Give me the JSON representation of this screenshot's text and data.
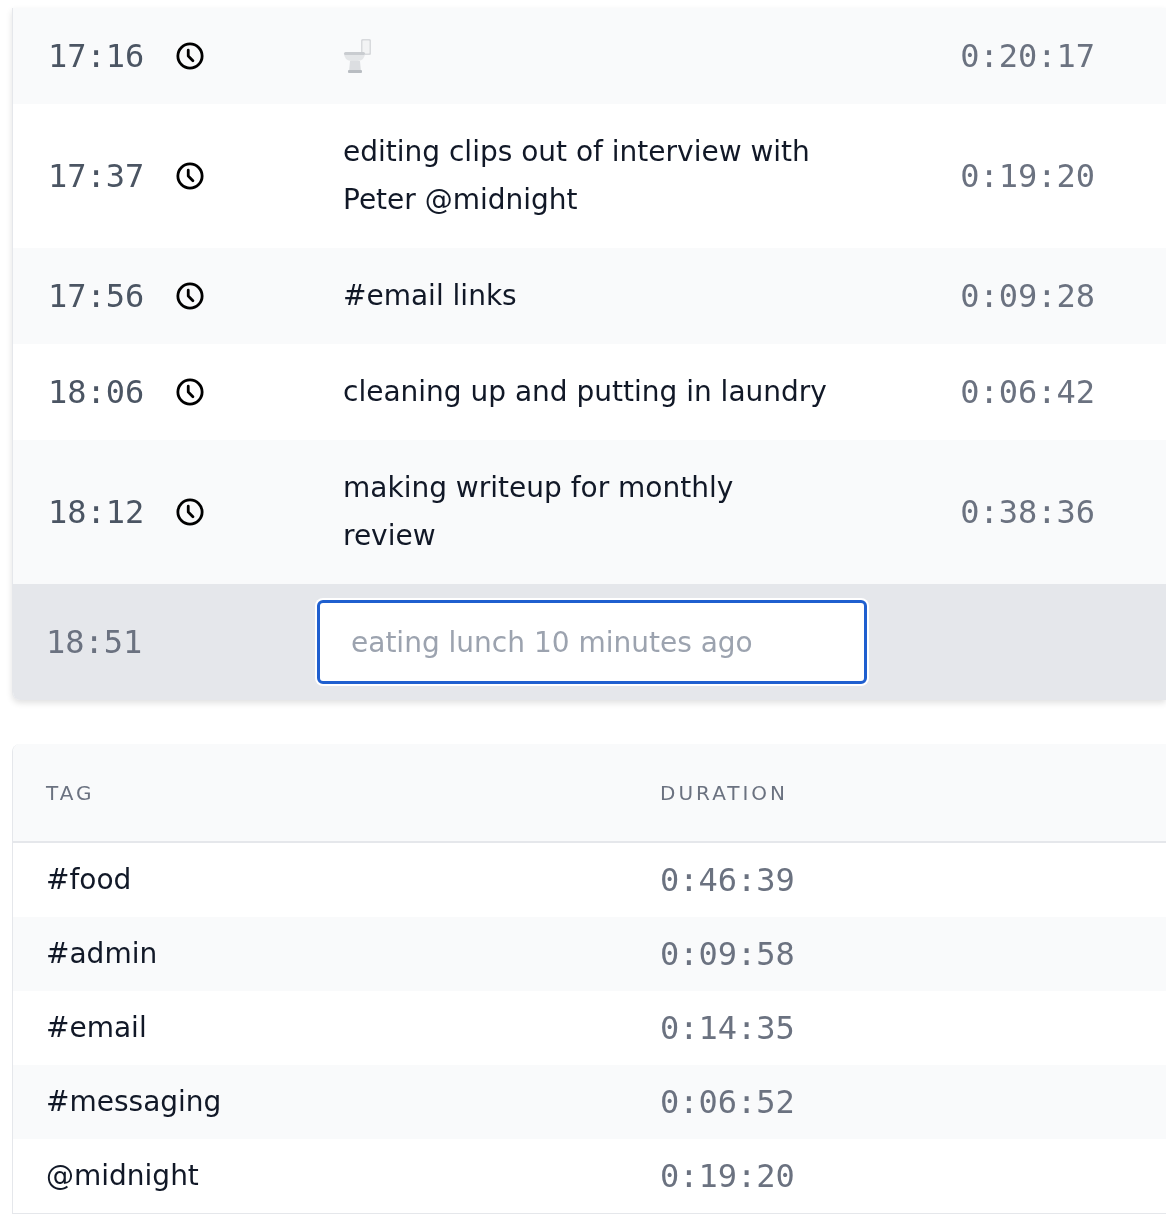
{
  "entries": [
    {
      "time": "17:16",
      "kind": "emoji",
      "duration": "0:20:17"
    },
    {
      "time": "17:37",
      "kind": "text",
      "description": "editing clips out of interview with Peter @midnight",
      "duration": "0:19:20"
    },
    {
      "time": "17:56",
      "kind": "text",
      "description": "#email links",
      "duration": "0:09:28"
    },
    {
      "time": "18:06",
      "kind": "text",
      "description": "cleaning up and putting in laundry",
      "duration": "0:06:42"
    },
    {
      "time": "18:12",
      "kind": "text",
      "description": "making writeup for monthly review",
      "duration": "0:38:36"
    }
  ],
  "new_entry": {
    "time": "18:51",
    "placeholder": "eating lunch 10 minutes ago",
    "focused": true
  },
  "tags_table": {
    "columns": [
      "TAG",
      "DURATION"
    ],
    "rows": [
      {
        "tag": "#food",
        "duration": "0:46:39"
      },
      {
        "tag": "#admin",
        "duration": "0:09:58"
      },
      {
        "tag": "#email",
        "duration": "0:14:35"
      },
      {
        "tag": "#messaging",
        "duration": "0:06:52"
      },
      {
        "tag": "@midnight",
        "duration": "0:19:20"
      }
    ]
  }
}
